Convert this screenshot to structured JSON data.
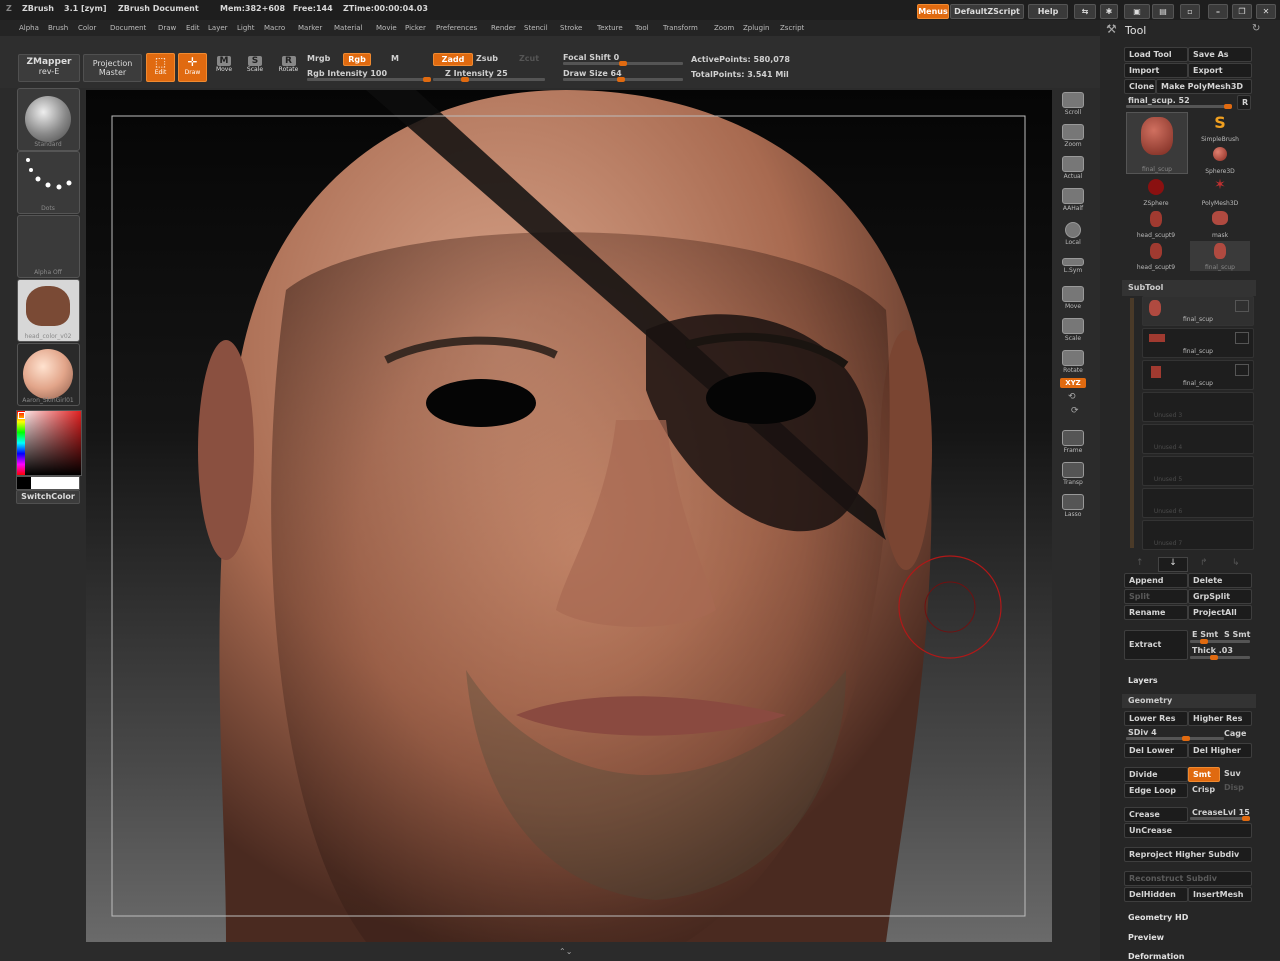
{
  "title_bar": {
    "app": "ZBrush",
    "version": "3.1 [zym]",
    "document": "ZBrush Document",
    "mem": "Mem:382+608",
    "free": "Free:144",
    "ztime": "ZTime:00:00:04.03",
    "menus_btn": "Menus",
    "script_btn": "DefaultZScript",
    "help_btn": "Help"
  },
  "menubar": [
    "Alpha",
    "Brush",
    "Color",
    "Document",
    "Draw",
    "Edit",
    "Layer",
    "Light",
    "Macro",
    "Marker",
    "Material",
    "Movie",
    "Picker",
    "Preferences",
    "Render",
    "Stencil",
    "Stroke",
    "Texture",
    "Tool",
    "Transform",
    "Zoom",
    "Zplugin",
    "Zscript"
  ],
  "shelf": {
    "zmapper": "ZMapper",
    "zmapper_sub": "rev-E",
    "projection": "Projection",
    "projection_sub": "Master",
    "edit": "Edit",
    "draw": "Draw",
    "move": "Move",
    "scale": "Scale",
    "rotate": "Rotate",
    "mrgb": "Mrgb",
    "rgb": "Rgb",
    "m": "M",
    "rgb_intensity": "Rgb Intensity 100",
    "zadd": "Zadd",
    "zsub": "Zsub",
    "zcut": "Zcut",
    "z_intensity": "Z Intensity 25",
    "focal_shift": "Focal Shift 0",
    "draw_size": "Draw Size 64",
    "active_points": "ActivePoints: 580,078",
    "total_points": "TotalPoints: 3.541 Mil",
    "rgb_intensity_value": 100,
    "z_intensity_value": 25,
    "draw_size_value": 64
  },
  "left_tray": {
    "brush": "Standard",
    "stroke": "Dots",
    "alpha": "Alpha Off",
    "texture": "head_color_v02",
    "material": "Aaron_SkinGirl01",
    "switch_color": "SwitchColor"
  },
  "right_vtray": [
    "Scroll",
    "Zoom",
    "Actual",
    "AAHalf",
    "Local",
    "L.Sym",
    "Move",
    "Scale",
    "Rotate",
    "Frame",
    "Transp",
    "Lasso"
  ],
  "xyz_label": "XYZ",
  "tool_panel": {
    "title": "Tool",
    "load_tool": "Load Tool",
    "save_as": "Save As",
    "import": "Import",
    "export": "Export",
    "clone": "Clone",
    "make_polymesh": "Make PolyMesh3D",
    "current_tool": "final_scup. 52",
    "r_btn": "R",
    "tools": [
      "final_scup",
      "SimpleBrush",
      "Sphere3D",
      "ZSphere",
      "PolyMesh3D",
      "head_scupt9",
      "mask",
      "head_scupt9",
      "final_scup"
    ]
  },
  "subtool": {
    "title": "SubTool",
    "rows": [
      "final_scup",
      "final_scup",
      "final_scup",
      "Unused 3",
      "Unused 4",
      "Unused 5",
      "Unused 6",
      "Unused 7"
    ],
    "append": "Append",
    "delete": "Delete",
    "split": "Split",
    "grpsplit": "GrpSplit",
    "rename": "Rename",
    "projectall": "ProjectAll",
    "extract": "Extract",
    "e_smt": "E Smt",
    "s_smt": "S Smt",
    "thick": "Thick .03"
  },
  "layers_title": "Layers",
  "geometry": {
    "title": "Geometry",
    "lower_res": "Lower Res",
    "higher_res": "Higher Res",
    "sdiv": "SDiv 4",
    "cage": "Cage",
    "del_lower": "Del Lower",
    "del_higher": "Del Higher",
    "divide": "Divide",
    "smt": "Smt",
    "suv": "Suv",
    "edge_loop": "Edge Loop",
    "crisp": "Crisp",
    "disp": "Disp",
    "crease": "Crease",
    "crease_lvl": "CreaseLvl 15",
    "uncrease": "UnCrease",
    "reproject": "Reproject Higher Subdiv",
    "reconstruct": "Reconstruct Subdiv",
    "delhidden": "DelHidden",
    "insertmesh": "InsertMesh"
  },
  "geometry_hd": "Geometry HD",
  "preview": "Preview",
  "deformation": "Deformation",
  "colors": {
    "accent": "#e06a10",
    "bg": "#2b2b2b"
  }
}
